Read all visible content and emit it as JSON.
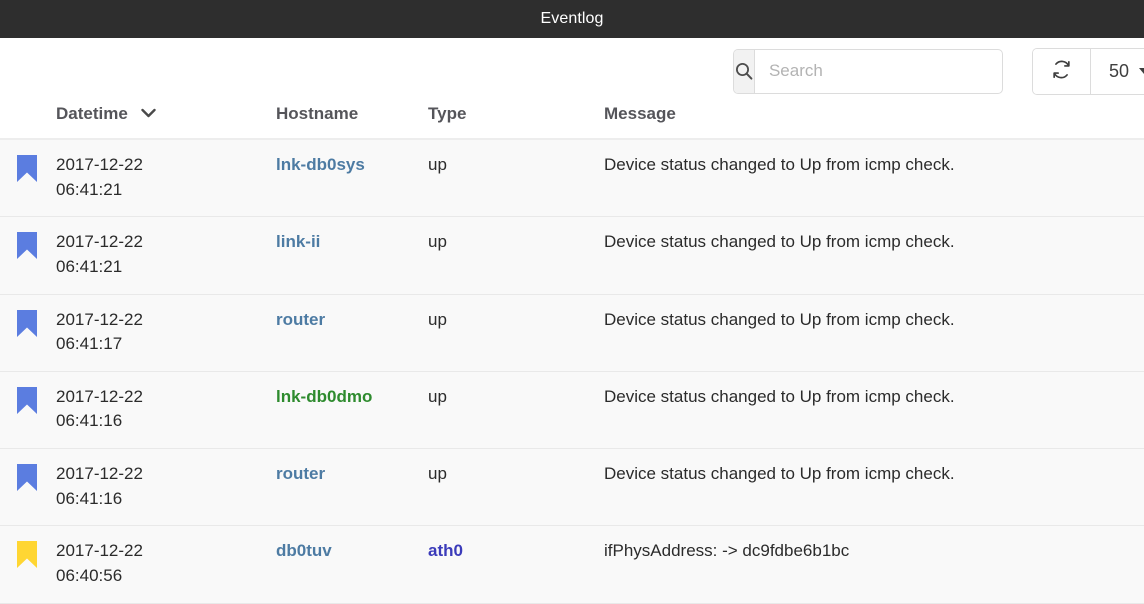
{
  "window": {
    "title": "Eventlog"
  },
  "toolbar": {
    "search": {
      "placeholder": "Search",
      "value": "",
      "icon": "search-icon"
    },
    "refresh": {
      "icon": "refresh-icon",
      "label": ""
    },
    "page_size": {
      "value": "50",
      "icon": "chevron-down-icon"
    }
  },
  "table": {
    "columns": [
      {
        "key": "datetime",
        "label": "Datetime",
        "sort": "desc",
        "sort_icon": "chevron-down-icon"
      },
      {
        "key": "hostname",
        "label": "Hostname"
      },
      {
        "key": "type",
        "label": "Type"
      },
      {
        "key": "message",
        "label": "Message"
      }
    ],
    "rows": [
      {
        "flag_color": "#5b7de0",
        "date": "2017-12-22",
        "time": "06:41:21",
        "hostname": "lnk-db0sys",
        "hostname_color": "#4d7ba3",
        "type": "up",
        "type_color": "#2b2b2b",
        "message": "Device status changed to Up from icmp check."
      },
      {
        "flag_color": "#5b7de0",
        "date": "2017-12-22",
        "time": "06:41:21",
        "hostname": "link-ii",
        "hostname_color": "#4d7ba3",
        "type": "up",
        "type_color": "#2b2b2b",
        "message": "Device status changed to Up from icmp check."
      },
      {
        "flag_color": "#5b7de0",
        "date": "2017-12-22",
        "time": "06:41:17",
        "hostname": "router",
        "hostname_color": "#4d7ba3",
        "type": "up",
        "type_color": "#2b2b2b",
        "message": "Device status changed to Up from icmp check."
      },
      {
        "flag_color": "#5b7de0",
        "date": "2017-12-22",
        "time": "06:41:16",
        "hostname": "lnk-db0dmo",
        "hostname_color": "#2e8b2e",
        "type": "up",
        "type_color": "#2b2b2b",
        "message": "Device status changed to Up from icmp check."
      },
      {
        "flag_color": "#5b7de0",
        "date": "2017-12-22",
        "time": "06:41:16",
        "hostname": "router",
        "hostname_color": "#4d7ba3",
        "type": "up",
        "type_color": "#2b2b2b",
        "message": "Device status changed to Up from icmp check."
      },
      {
        "flag_color": "#ffd633",
        "date": "2017-12-22",
        "time": "06:40:56",
        "hostname": "db0tuv",
        "hostname_color": "#4d7ba3",
        "type": "ath0",
        "type_color": "#3b3bba",
        "message": "ifPhysAddress: -> dc9fdbe6b1bc"
      }
    ]
  }
}
